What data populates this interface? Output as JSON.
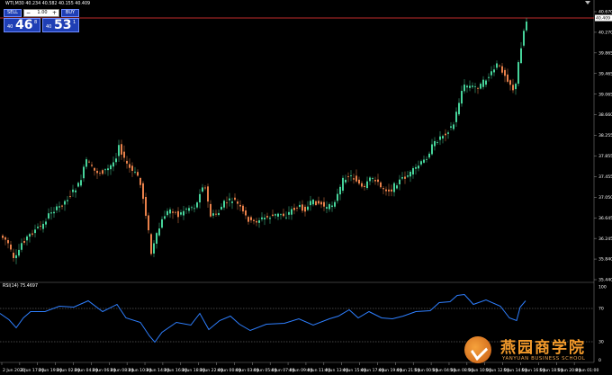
{
  "chart": {
    "symbol_line": "WTI,M30  40.234 40.582 40.155 40.409",
    "current_price_label": "40.409",
    "price_ticks": [
      "40.670",
      "40.270",
      "39.865",
      "39.465",
      "39.065",
      "38.660",
      "38.255",
      "37.855",
      "37.455",
      "37.050",
      "36.645",
      "36.245",
      "35.840",
      "35.440"
    ],
    "time_labels": [
      "2 Jun 2020",
      "2 Jun 17:00",
      "2 Jun 19:00",
      "3 Jun 02:00",
      "3 Jun 04:00",
      "3 Jun 06:00",
      "3 Jun 08:00",
      "3 Jun 10:00",
      "3 Jun 14:00",
      "3 Jun 16:00",
      "3 Jun 18:00",
      "3 Jun 22:00",
      "4 Jun 00:00",
      "4 Jun 03:00",
      "4 Jun 05:00",
      "4 Jun 07:00",
      "4 Jun 09:00",
      "4 Jun 11:00",
      "4 Jun 13:00",
      "4 Jun 15:00",
      "4 Jun 17:00",
      "4 Jun 19:00",
      "4 Jun 21:00",
      "5 Jun 00:00",
      "5 Jun 04:00",
      "5 Jun 08:00",
      "5 Jun 10:00",
      "5 Jun 12:00",
      "5 Jun 14:00",
      "5 Jun 16:00",
      "5 Jun 18:00",
      "5 Jun 20:00",
      "8 Jun 01:00"
    ],
    "colors": {
      "bull": "#46d39a",
      "bear": "#e8804a",
      "grid": "#3a3a3a",
      "price_line": "#ff3b3b",
      "rsi": "#2e7fff",
      "bg": "#000000"
    }
  },
  "trade_panel": {
    "sell_label": "SELL",
    "buy_label": "BUY",
    "lot_value": "1.00",
    "minus_icon": "−",
    "plus_icon": "+",
    "bid_prefix": "40",
    "bid_big": "46",
    "bid_sup": "8",
    "ask_prefix": "40",
    "ask_big": "53",
    "ask_sup": "1"
  },
  "rsi": {
    "info_line": "RSI(14) 75.4697",
    "level_high": "70",
    "level_low": "30",
    "max_label": "100",
    "min_label": "0"
  },
  "watermark": {
    "title": "燕园商学院",
    "subtitle": "YANYUAN BUSINESS SCHOOL"
  }
}
